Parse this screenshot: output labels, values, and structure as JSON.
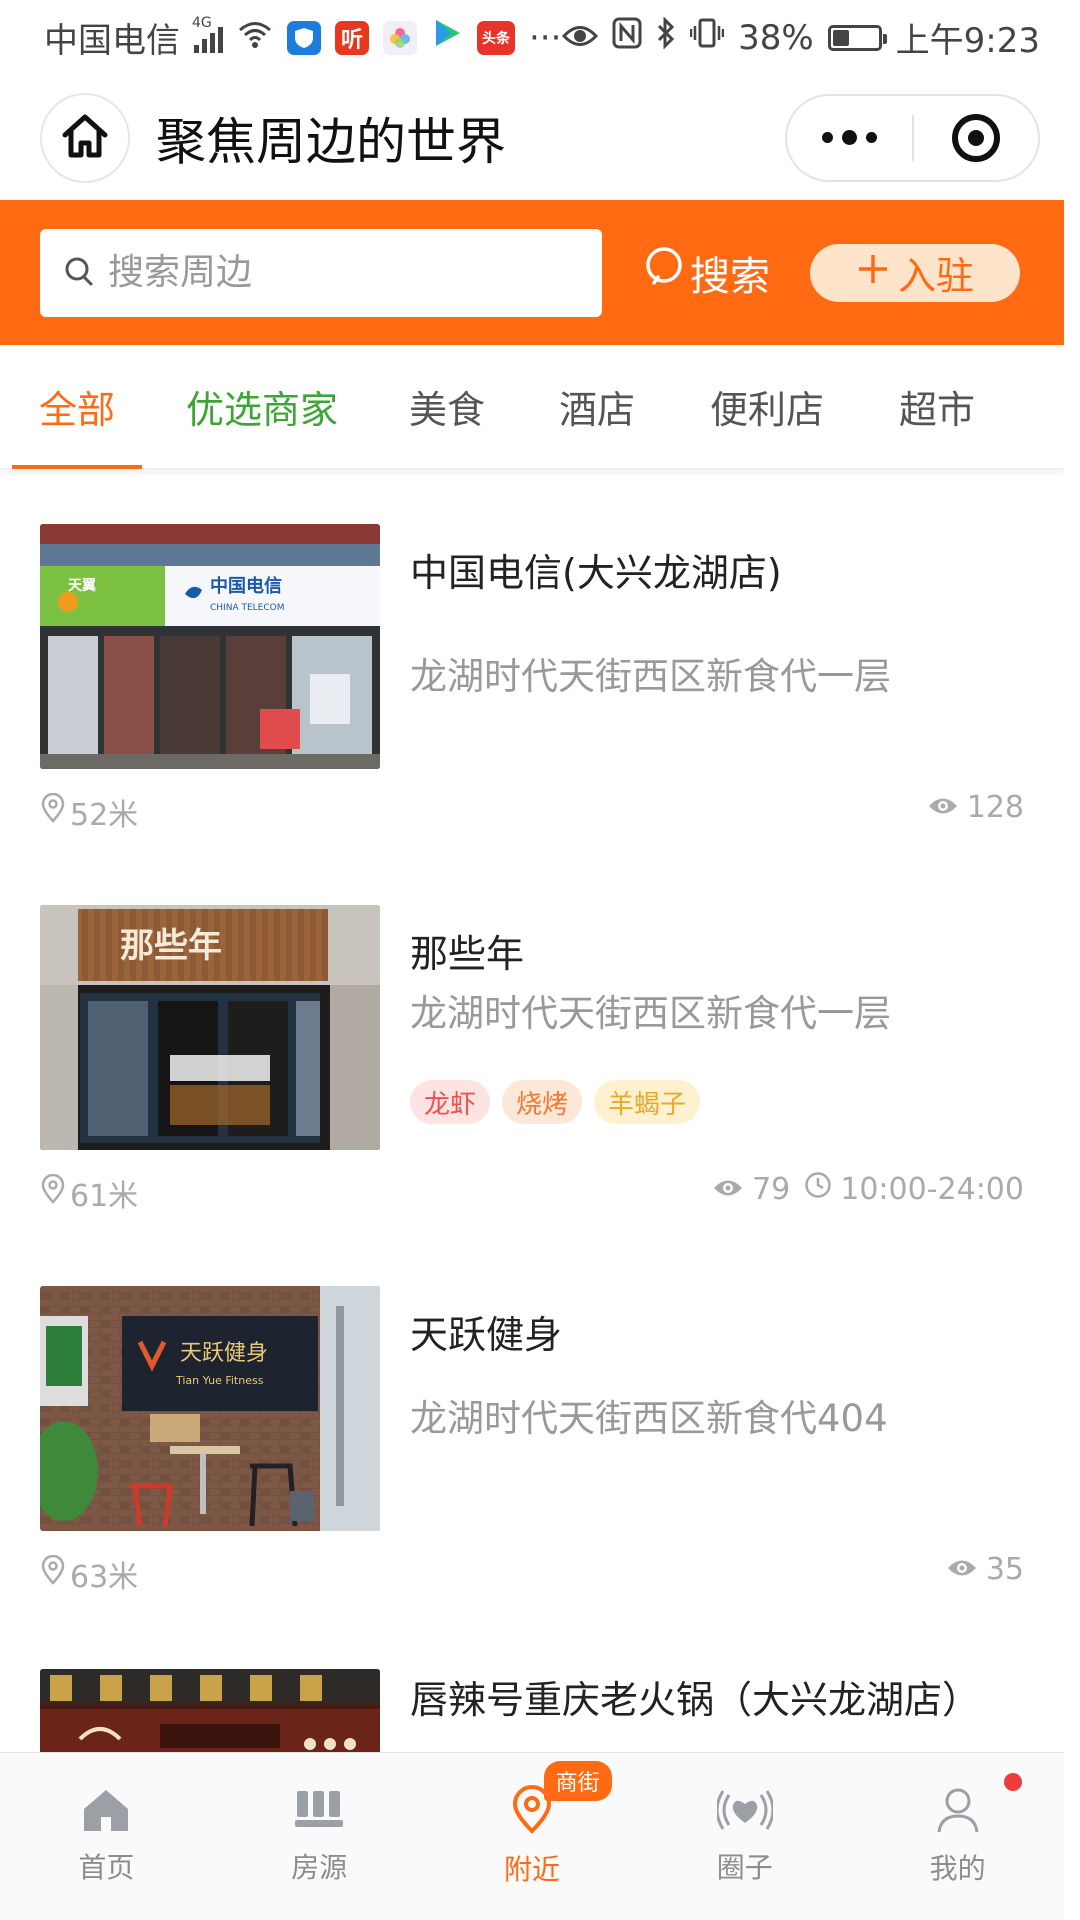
{
  "status_bar": {
    "carrier": "中国电信",
    "network": "4G",
    "app_icons": [
      "shield-app",
      "听",
      "flower-app",
      "play-app",
      "头条"
    ],
    "more": "···",
    "battery": "38%",
    "time": "上午9:23"
  },
  "header": {
    "title": "聚焦周边的世界"
  },
  "search": {
    "placeholder": "搜索周边",
    "button_label": "搜索",
    "join_label": "入驻"
  },
  "tabs": [
    {
      "label": "全部",
      "active": true
    },
    {
      "label": "优选商家",
      "active": false
    },
    {
      "label": "美食",
      "active": false
    },
    {
      "label": "酒店",
      "active": false
    },
    {
      "label": "便利店",
      "active": false
    },
    {
      "label": "超市",
      "active": false
    }
  ],
  "listings": [
    {
      "name": "中国电信(大兴龙湖店)",
      "address": "龙湖时代天街西区新食代一层",
      "distance": "52米",
      "views": "128",
      "hours": "",
      "tags": []
    },
    {
      "name": "那些年",
      "address": "龙湖时代天街西区新食代一层",
      "distance": "61米",
      "views": "79",
      "hours": "10:00-24:00",
      "tags": [
        "龙虾",
        "烧烤",
        "羊蝎子"
      ]
    },
    {
      "name": "天跃健身",
      "address": "龙湖时代天街西区新食代404",
      "distance": "63米",
      "views": "35",
      "hours": "",
      "tags": []
    },
    {
      "name": "唇辣号重庆老火锅（大兴龙湖店）",
      "address": "",
      "distance": "",
      "views": "",
      "hours": "",
      "tags": []
    }
  ],
  "images": {
    "telecom_store_sign": "中国电信",
    "telecom_store_sign_en": "CHINA TELECOM",
    "tianyi_sign": "天翼",
    "naxienian_sign": "那些年",
    "gym_sign": "天跃健身",
    "gym_sign_en": "Tian Yue Fitness"
  },
  "bottom_nav": [
    {
      "label": "首页",
      "icon": "home-icon",
      "active": false
    },
    {
      "label": "房源",
      "icon": "listing-icon",
      "active": false
    },
    {
      "label": "附近",
      "icon": "location-icon",
      "active": true,
      "badge": "商街"
    },
    {
      "label": "圈子",
      "icon": "circle-heart-icon",
      "active": false
    },
    {
      "label": "我的",
      "icon": "user-icon",
      "active": false,
      "dot": true
    }
  ],
  "colors": {
    "brand_orange": "#ff6a13",
    "join_bg": "#ffe4cc",
    "preferred_green": "#3da535",
    "tag_red_bg": "#fde3e1",
    "tag_red_text": "#f0504a",
    "tag_orange_bg": "#fde8d7",
    "tag_orange_text": "#f07a35",
    "tag_yellow_bg": "#fdf1cf",
    "tag_yellow_text": "#e9a92a"
  }
}
